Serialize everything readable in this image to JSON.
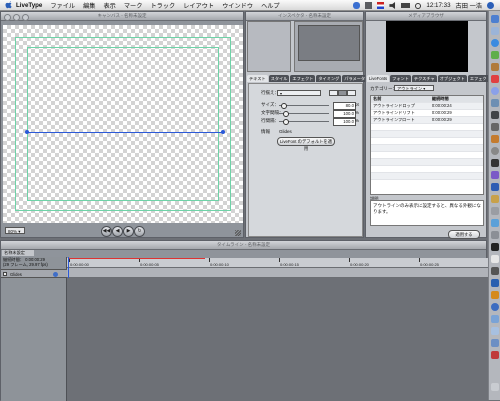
{
  "menubar": {
    "app": "LiveType",
    "items": [
      "ファイル",
      "編集",
      "表示",
      "マーク",
      "トラック",
      "レイアウト",
      "ウインドウ",
      "ヘルプ"
    ],
    "time": "12:17:33",
    "user": "古田 一浩"
  },
  "canvas": {
    "title": "キャンバス - 名称未設定",
    "zoom": "80%"
  },
  "inspector": {
    "title": "インスペクタ - 名称未設定",
    "tabs": [
      "テキスト",
      "スタイル",
      "エフェクト",
      "タイミング",
      "パラメータ"
    ],
    "active_tab": "テキスト",
    "align_label": "行揃え：",
    "size_label": "サイズ：",
    "size_value": "80.0",
    "tracking_label": "文字間隔：",
    "tracking_value": "100.0",
    "leading_label": "行間隔：",
    "leading_value": "100.0",
    "info_label": "情報",
    "info_value": "Glides",
    "default_button": "LiveFont のデフォルトを適用"
  },
  "library": {
    "title": "メディアブラウザ",
    "tabs": [
      "LiveFonts",
      "フォント",
      "テクスチャ",
      "オブジェクト",
      "エフェクト"
    ],
    "category_label": "カテゴリー：",
    "category_value": "アウトライン",
    "columns": [
      "名前",
      "継続時間"
    ],
    "rows": [
      {
        "name": "アウトラインドロップ",
        "duration": "0:00:00:24"
      },
      {
        "name": "アウトラインドリフト",
        "duration": "0:00:00:29"
      },
      {
        "name": "アウトラインフロート",
        "duration": "0:00:00:29"
      }
    ],
    "desc_label": "説明",
    "description": "アウトラインのみ表示に設定すると、異なる外観になります。",
    "apply_button": "適用する"
  },
  "timeline": {
    "title": "タイムライン - 名称未設定",
    "project_label": "名称未設定",
    "duration_label": "継続時間：",
    "duration_value": "0:00:00:29",
    "frames_info": "(29 フレーム, 29.97 fps)",
    "track_name": "Glides",
    "ruler": [
      "0:00:00:00",
      "0:00:00:05",
      "0:00:00:10",
      "0:00:00:15",
      "0:00:00:20",
      "0:00:00:25"
    ]
  }
}
